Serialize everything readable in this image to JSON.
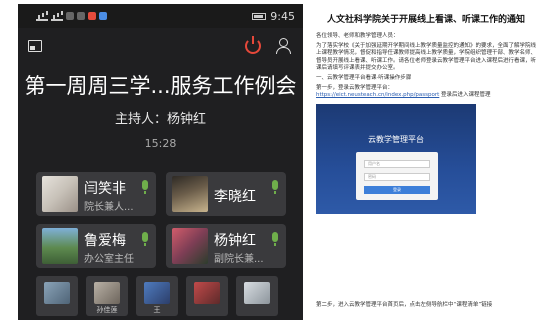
{
  "status_bar": {
    "time": "9:45"
  },
  "meeting": {
    "title": "第一周周三学...服务工作例会",
    "host": "主持人：杨钟红",
    "elapsed": "15:28"
  },
  "participants": [
    {
      "name": "闫笑非",
      "role": "院长兼人..."
    },
    {
      "name": "李晓红",
      "role": ""
    },
    {
      "name": "鲁爱梅",
      "role": "办公室主任"
    },
    {
      "name": "杨钟红",
      "role": "副院长兼..."
    }
  ],
  "thumbnails": [
    {
      "label": ""
    },
    {
      "label": "孙佳莲"
    },
    {
      "label": "王"
    },
    {
      "label": ""
    },
    {
      "label": ""
    }
  ],
  "doc": {
    "title": "人文社科学院关于开展线上看课、听课工作的通知",
    "para1": "各位领导、老师和教学管理人员：",
    "para2": "为了落实学校《关于加强延期开学期间线上教学质量监控的通知》的要求，全面了解学院线上课程教学情况，督促和指导任课教师提高线上教学质量，学院组织管理干部、教学名师、督导员开展线上看课、听课工作。请各位老师登录云教学管理平台进入课程后进行看课，听课后请填写评课表并提交办公室。",
    "section": "一、云教学管理平台看课·听课操作步骤",
    "step1": "第一步，登录云教学管理平台：",
    "url": "https://eict.neusteach.cn/index.php/passport",
    "step1_tail": "登录后进入课程管理",
    "platform_title": "云教学管理平台",
    "login_user_placeholder": "用户名",
    "login_pass_placeholder": "密码",
    "login_button": "登录",
    "step2": "第二步，进入云教学管理平台首页后，点击左侧导航栏中“课程清单”链接"
  }
}
